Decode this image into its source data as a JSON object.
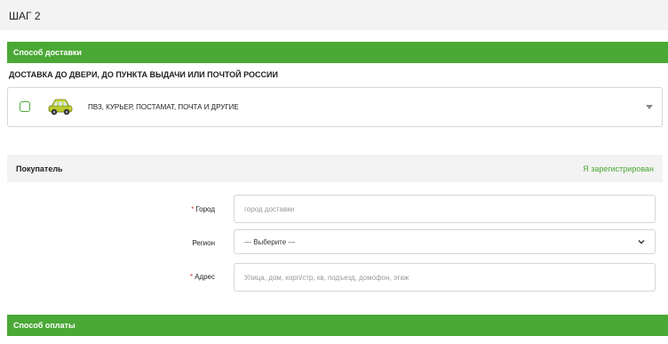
{
  "step": {
    "title": "ШАГ 2"
  },
  "delivery": {
    "section_title": "Способ доставки",
    "heading": "ДОСТАВКА ДО ДВЕРИ, ДО ПУНКТА ВЫДАЧИ ИЛИ ПОЧТОЙ РОССИИ",
    "option_label": "ПВЗ, КУРЬЕР, ПОСТАМАТ, ПОЧТА И ДРУГИЕ",
    "option_icon": "car-icon"
  },
  "buyer": {
    "title": "Покупатель",
    "registered_link": "Я зарегистрирован",
    "city": {
      "required_mark": "*",
      "label": "Город",
      "placeholder": "город доставки"
    },
    "region": {
      "label": "Регион",
      "selected": "--- Выберите ---"
    },
    "address": {
      "required_mark": "*",
      "label": "Адрес",
      "placeholder": "Улица, дом, корп/стр, кв, подъезд, домофон, этаж"
    }
  },
  "payment": {
    "section_title": "Способ оплаты"
  },
  "colors": {
    "accent": "#4aa835",
    "required": "#d9322b",
    "header_bg": "#f3f3f3"
  }
}
